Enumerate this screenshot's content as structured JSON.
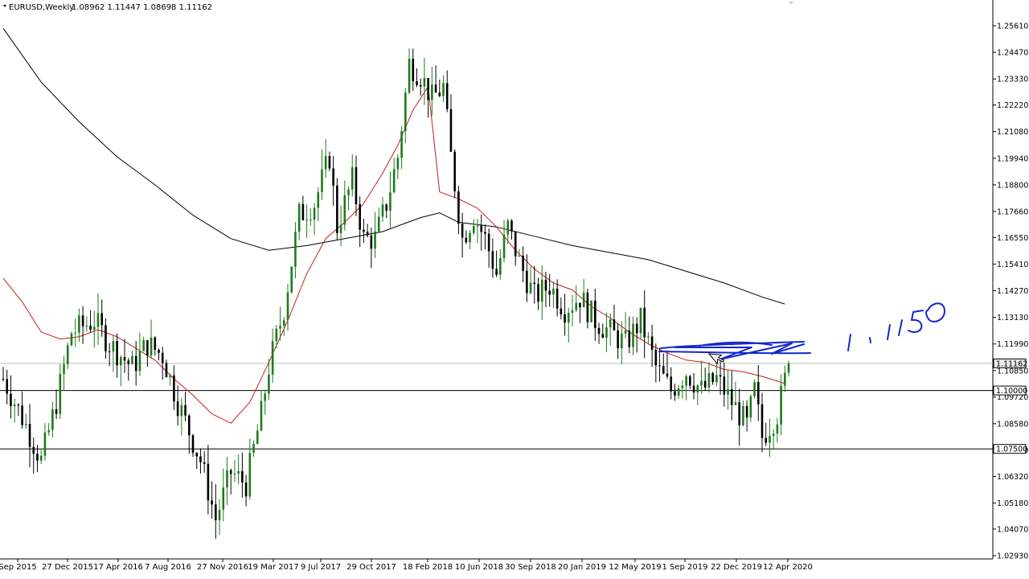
{
  "header": {
    "symbol": "EURUSD,Weekly",
    "ohlc": "1.08962 1.11447 1.08698 1.11162"
  },
  "colors": {
    "background": "#ffffff",
    "bull_candle": "#1f7a1f",
    "bear_candle": "#000000",
    "ma_fast": "#c81e1e",
    "ma_slow": "#000000",
    "horizontal_line": "#000000",
    "current_price_line": "#c0c0c0",
    "drawing": "#1428c8"
  },
  "chart_data": {
    "type": "candlestick",
    "symbol": "EURUSD",
    "timeframe": "Weekly",
    "ylim": [
      1.0293,
      1.2561
    ],
    "y_ticks": [
      "1.25610",
      "1.24470",
      "1.23330",
      "1.22220",
      "1.21080",
      "1.19940",
      "1.18800",
      "1.17660",
      "1.16550",
      "1.15410",
      "1.14270",
      "1.13130",
      "1.11990",
      "1.10850",
      "1.09720",
      "1.08580",
      "1.07440",
      "1.06320",
      "1.05180",
      "1.04070",
      "1.02930"
    ],
    "x_ticks": [
      "Sep 2015",
      "27 Dec 2015",
      "17 Apr 2016",
      "7 Aug 2016",
      "27 Nov 2016",
      "19 Mar 2017",
      "9 Jul 2017",
      "29 Oct 2017",
      "18 Feb 2018",
      "10 Jun 2018",
      "30 Sep 2018",
      "20 Jan 2019",
      "12 May 2019",
      "1 Sep 2019",
      "22 Dec 2019",
      "12 Apr 2020"
    ],
    "current_price": "1.11162",
    "horizontal_levels": [
      {
        "value": 1.1,
        "label": "1.10000"
      },
      {
        "value": 1.075,
        "label": "1.07500"
      }
    ],
    "anchors": [
      [
        0,
        1.105
      ],
      [
        6,
        1.085
      ],
      [
        10,
        1.07
      ],
      [
        14,
        1.095
      ],
      [
        18,
        1.125
      ],
      [
        24,
        1.13
      ],
      [
        28,
        1.12
      ],
      [
        34,
        1.11
      ],
      [
        38,
        1.12
      ],
      [
        42,
        1.115
      ],
      [
        46,
        1.095
      ],
      [
        52,
        1.07
      ],
      [
        56,
        1.045
      ],
      [
        60,
        1.065
      ],
      [
        64,
        1.06
      ],
      [
        68,
        1.09
      ],
      [
        70,
        1.11
      ],
      [
        74,
        1.135
      ],
      [
        78,
        1.175
      ],
      [
        82,
        1.18
      ],
      [
        86,
        1.2
      ],
      [
        88,
        1.17
      ],
      [
        92,
        1.19
      ],
      [
        95,
        1.165
      ],
      [
        98,
        1.165
      ],
      [
        101,
        1.18
      ],
      [
        104,
        1.2
      ],
      [
        107,
        1.24
      ],
      [
        110,
        1.235
      ],
      [
        113,
        1.225
      ],
      [
        116,
        1.23
      ],
      [
        118,
        1.2
      ],
      [
        121,
        1.165
      ],
      [
        124,
        1.175
      ],
      [
        127,
        1.165
      ],
      [
        130,
        1.15
      ],
      [
        133,
        1.17
      ],
      [
        136,
        1.155
      ],
      [
        140,
        1.14
      ],
      [
        144,
        1.145
      ],
      [
        148,
        1.135
      ],
      [
        152,
        1.14
      ],
      [
        156,
        1.13
      ],
      [
        160,
        1.125
      ],
      [
        164,
        1.12
      ],
      [
        168,
        1.13
      ],
      [
        172,
        1.11
      ],
      [
        176,
        1.1
      ],
      [
        180,
        1.108
      ],
      [
        184,
        1.1
      ],
      [
        188,
        1.105
      ],
      [
        192,
        1.095
      ],
      [
        196,
        1.085
      ],
      [
        198,
        1.1
      ],
      [
        200,
        1.08
      ],
      [
        204,
        1.09
      ],
      [
        207,
        1.11162
      ]
    ],
    "ma_fast": [
      [
        0,
        1.148
      ],
      [
        5,
        1.138
      ],
      [
        10,
        1.125
      ],
      [
        15,
        1.122
      ],
      [
        20,
        1.123
      ],
      [
        25,
        1.126
      ],
      [
        30,
        1.123
      ],
      [
        35,
        1.118
      ],
      [
        40,
        1.113
      ],
      [
        45,
        1.105
      ],
      [
        50,
        1.098
      ],
      [
        55,
        1.09
      ],
      [
        60,
        1.086
      ],
      [
        65,
        1.095
      ],
      [
        70,
        1.112
      ],
      [
        75,
        1.13
      ],
      [
        80,
        1.15
      ],
      [
        85,
        1.165
      ],
      [
        90,
        1.172
      ],
      [
        95,
        1.18
      ],
      [
        100,
        1.193
      ],
      [
        104,
        1.205
      ],
      [
        108,
        1.22
      ],
      [
        112,
        1.23
      ],
      [
        115,
        1.185
      ],
      [
        120,
        1.182
      ],
      [
        125,
        1.178
      ],
      [
        130,
        1.17
      ],
      [
        135,
        1.16
      ],
      [
        140,
        1.152
      ],
      [
        145,
        1.146
      ],
      [
        150,
        1.143
      ],
      [
        155,
        1.136
      ],
      [
        160,
        1.131
      ],
      [
        165,
        1.125
      ],
      [
        170,
        1.12
      ],
      [
        175,
        1.116
      ],
      [
        180,
        1.113
      ],
      [
        185,
        1.112
      ],
      [
        190,
        1.109
      ],
      [
        195,
        1.108
      ],
      [
        200,
        1.106
      ],
      [
        204,
        1.104
      ],
      [
        206,
        1.103
      ]
    ],
    "ma_slow": [
      [
        0,
        1.255
      ],
      [
        10,
        1.232
      ],
      [
        20,
        1.215
      ],
      [
        30,
        1.2
      ],
      [
        40,
        1.188
      ],
      [
        50,
        1.175
      ],
      [
        60,
        1.165
      ],
      [
        70,
        1.16
      ],
      [
        80,
        1.162
      ],
      [
        90,
        1.165
      ],
      [
        100,
        1.168
      ],
      [
        110,
        1.174
      ],
      [
        115,
        1.176
      ],
      [
        120,
        1.172
      ],
      [
        130,
        1.17
      ],
      [
        140,
        1.166
      ],
      [
        150,
        1.162
      ],
      [
        160,
        1.159
      ],
      [
        170,
        1.156
      ],
      [
        180,
        1.151
      ],
      [
        190,
        1.146
      ],
      [
        200,
        1.14
      ],
      [
        206,
        1.137
      ]
    ]
  },
  "annotations": {
    "price_labels": [
      {
        "label": "1.11162"
      },
      {
        "label": "1.10000"
      },
      {
        "label": "1.07500"
      }
    ]
  }
}
